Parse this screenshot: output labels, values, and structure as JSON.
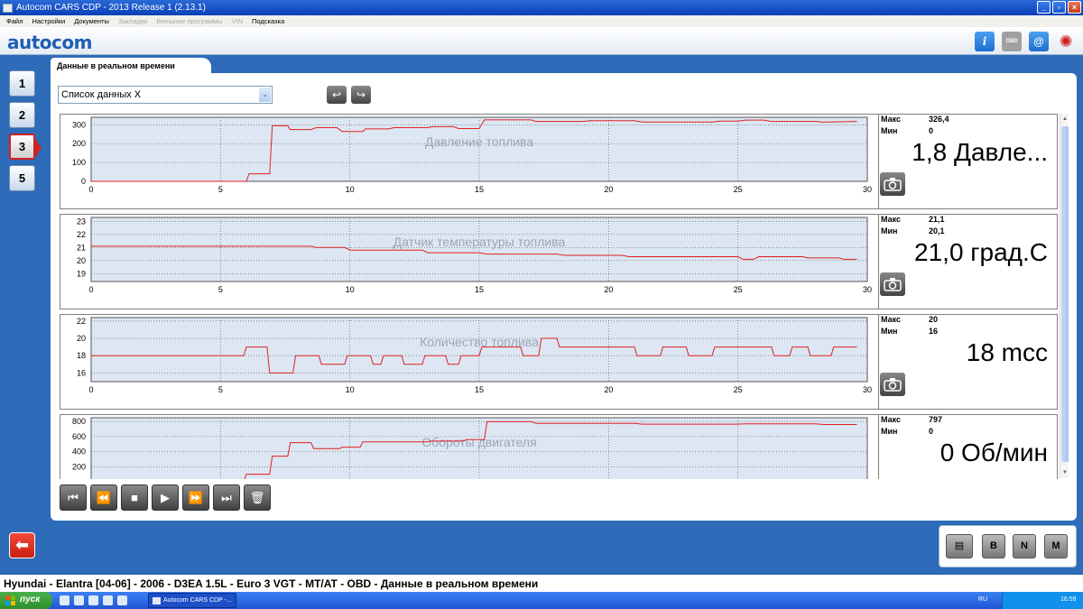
{
  "window": {
    "title": "Autocom CARS CDP - 2013 Release 1 (2.13.1)",
    "btn_minimize": "_",
    "btn_maximize": "▫",
    "btn_close": "×"
  },
  "menu": {
    "items": [
      {
        "label": "Файл",
        "enabled": true
      },
      {
        "label": "Настройки",
        "enabled": true
      },
      {
        "label": "Документы",
        "enabled": true
      },
      {
        "label": "Закладки",
        "enabled": false
      },
      {
        "label": "Внешние программы",
        "enabled": false
      },
      {
        "label": "VIN",
        "enabled": false
      },
      {
        "label": "Подсказка",
        "enabled": true
      }
    ]
  },
  "logo": {
    "text": "autocom"
  },
  "toolbar": {
    "info_icon": "i",
    "obd_icon": "OBD",
    "help_icon": "@",
    "spinner_icon": "✺"
  },
  "steps": {
    "buttons": [
      {
        "label": "1",
        "active": false
      },
      {
        "label": "2",
        "active": false
      },
      {
        "label": "3",
        "active": true
      },
      {
        "label": "5",
        "active": false
      }
    ],
    "back_icon": "⬅"
  },
  "tab": {
    "label": "Данные в реальном времени"
  },
  "list": {
    "selected": "Список данных X",
    "arrow": "⌄"
  },
  "nav": {
    "prev": "↩",
    "next": "↪"
  },
  "x_axis": {
    "min": 0,
    "max": 30,
    "ticks": [
      0,
      5,
      10,
      15,
      20,
      25,
      30
    ]
  },
  "labels": {
    "max": "Макс",
    "min": "Мин"
  },
  "charts": [
    {
      "title": "Давление топлива",
      "max": "326,4",
      "min": "0",
      "value": "1,8 Давле...",
      "y_ticks": [
        0,
        100,
        200,
        300
      ],
      "ylim": [
        0,
        340
      ]
    },
    {
      "title": "Датчик температуры топлива",
      "max": "21,1",
      "min": "20,1",
      "value": "21,0 град.С",
      "y_ticks": [
        19,
        20,
        21,
        22,
        23
      ],
      "ylim": [
        18.4,
        23.3
      ]
    },
    {
      "title": "Количество топлива",
      "max": "20",
      "min": "16",
      "value": "18 mcc",
      "y_ticks": [
        16,
        18,
        20,
        22
      ],
      "ylim": [
        15,
        22.4
      ]
    },
    {
      "title": "Обороты двигателя",
      "max": "797",
      "min": "0",
      "value": "0 Об/мин",
      "y_ticks": [
        200,
        400,
        600,
        800
      ],
      "ylim": [
        0,
        850
      ]
    }
  ],
  "chart_data": [
    {
      "type": "line",
      "title": "Давление топлива",
      "xlim": [
        0,
        30
      ],
      "ylim": [
        0,
        340
      ],
      "series": [
        {
          "x": [
            0,
            6,
            6.1,
            6.9,
            7,
            7.6,
            7.7,
            8.5,
            8.7,
            9.5,
            9.7,
            10.5,
            10.6,
            11.5,
            11.7,
            13,
            13.2,
            14,
            14.2,
            15,
            15.2,
            17,
            17.2,
            19,
            19.3,
            21,
            21.3,
            24,
            24.3,
            25,
            25.3,
            26,
            26.3,
            28,
            28.3,
            29.6
          ],
          "y": [
            0,
            0,
            40,
            40,
            295,
            295,
            275,
            275,
            285,
            285,
            265,
            265,
            278,
            278,
            285,
            285,
            290,
            290,
            280,
            280,
            326,
            326,
            318,
            318,
            322,
            322,
            315,
            315,
            320,
            320,
            325,
            325,
            318,
            318,
            314,
            318
          ]
        }
      ]
    },
    {
      "type": "line",
      "title": "Датчик температуры топлива",
      "xlim": [
        0,
        30
      ],
      "ylim": [
        18.4,
        23.3
      ],
      "series": [
        {
          "x": [
            0,
            8.5,
            8.7,
            9.8,
            10,
            12.8,
            13,
            15,
            15.3,
            18,
            18.3,
            20.5,
            20.8,
            25,
            25.2,
            25.6,
            25.8,
            27.5,
            27.7,
            28.9,
            29.1,
            29.6
          ],
          "y": [
            21.1,
            21.1,
            21.0,
            21.0,
            20.8,
            20.8,
            20.6,
            20.6,
            20.5,
            20.5,
            20.4,
            20.4,
            20.3,
            20.3,
            20.1,
            20.1,
            20.3,
            20.3,
            20.2,
            20.2,
            20.1,
            20.1
          ]
        }
      ]
    },
    {
      "type": "line",
      "title": "Количество топлива",
      "xlim": [
        0,
        30
      ],
      "ylim": [
        15,
        22.4
      ],
      "series": [
        {
          "x": [
            0,
            5.9,
            6,
            6.8,
            6.9,
            7.8,
            7.9,
            8.8,
            8.9,
            9.8,
            9.9,
            10.8,
            10.9,
            11.2,
            11.3,
            12,
            12.1,
            12.8,
            12.9,
            13.7,
            13.8,
            14.2,
            14.3,
            15,
            15.1,
            16.6,
            16.7,
            17.3,
            17.4,
            18,
            18.1,
            21,
            21.1,
            22,
            22.1,
            23,
            23.1,
            24,
            24.1,
            26.3,
            26.4,
            27,
            27.1,
            27.7,
            27.8,
            28.6,
            28.7,
            29.6
          ],
          "y": [
            18,
            18,
            19,
            19,
            16,
            16,
            18,
            18,
            17,
            17,
            18,
            18,
            17,
            17,
            18,
            18,
            17,
            17,
            18,
            18,
            17,
            17,
            18,
            18,
            19,
            19,
            18,
            18,
            20,
            20,
            19,
            19,
            18,
            18,
            19,
            19,
            18,
            18,
            19,
            19,
            18,
            18,
            19,
            19,
            18,
            18,
            19,
            19
          ]
        }
      ]
    },
    {
      "type": "line",
      "title": "Обороты двигателя",
      "xlim": [
        0,
        30
      ],
      "ylim": [
        0,
        850
      ],
      "series": [
        {
          "x": [
            0,
            5.9,
            6,
            6.9,
            7,
            7.6,
            7.7,
            8.5,
            8.6,
            9.6,
            9.7,
            10.4,
            10.5,
            13,
            13.1,
            14.4,
            14.5,
            15.2,
            15.3,
            17,
            17.2,
            21,
            21.3,
            25,
            25.3,
            28,
            28.3,
            29.6
          ],
          "y": [
            0,
            0,
            100,
            100,
            340,
            340,
            520,
            520,
            440,
            440,
            460,
            460,
            530,
            530,
            540,
            540,
            560,
            560,
            797,
            797,
            775,
            775,
            765,
            765,
            770,
            770,
            760,
            760
          ]
        }
      ]
    }
  ],
  "playback": {
    "icons": [
      "⏮",
      "⏪",
      "■",
      "▶",
      "⏩",
      "⏭",
      "🗑"
    ]
  },
  "bottom_right": {
    "print_icon": "▤",
    "btn_b": "B",
    "btn_n": "N",
    "btn_m": "M"
  },
  "statusline": {
    "text": "Hyundai - Elantra [04-06] - 2006 - D3EA 1.5L - Euro 3 VGT - MT/AT - OBD - Данные в реальном времени"
  },
  "taskbar": {
    "start": "пуск",
    "task": "Autocom CARS CDP -...",
    "lang": "RU",
    "time": "16:59"
  },
  "colors": {
    "plot_bg": "#dde6f3",
    "plot_line": "#e02020",
    "title_text": "#9aa6b8",
    "grid": "#555555"
  }
}
